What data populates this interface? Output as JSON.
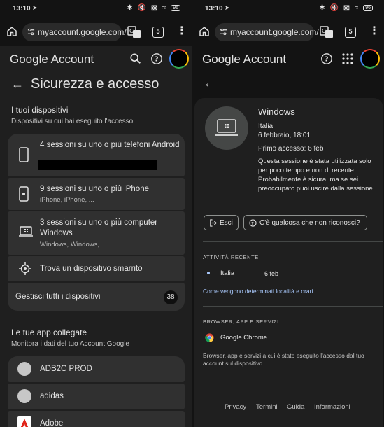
{
  "status": {
    "time": "13:10",
    "battery": "96"
  },
  "browser": {
    "url": "myaccount.google.com/",
    "tab_count": "5"
  },
  "brand": {
    "google": "Google",
    "account": "Account"
  },
  "left": {
    "page_title": "Sicurezza e accesso",
    "devices_title": "I tuoi dispositivi",
    "devices_sub": "Dispositivi su cui hai eseguito l'accesso",
    "device_android": "4 sessioni su uno o più telefoni Android",
    "device_iphone": "9 sessioni su uno o più iPhone",
    "device_iphone_sub": "iPhone, iPhone, ...",
    "device_computer": "3 sessioni su uno o più computer Windows",
    "device_computer_sub": "Windows, Windows, ...",
    "find_device": "Trova un dispositivo smarrito",
    "manage_devices": "Gestisci tutti i dispositivi",
    "manage_count": "38",
    "apps_title": "Le tue app collegate",
    "apps_sub": "Monitora i dati del tuo Account Google",
    "apps": [
      "ADB2C PROD",
      "adidas",
      "Adobe"
    ]
  },
  "right": {
    "device_name": "Windows",
    "location": "Italia",
    "datetime": "6 febbraio, 18:01",
    "first_access": "Primo accesso: 6 feb",
    "note": "Questa sessione è stata utilizzata solo per poco tempo e non di recente. Probabilmente è sicura, ma se sei preoccupato puoi uscire dalla sessione.",
    "logout_label": "Esci",
    "unknown_label": "C'è qualcosa che non riconosci?",
    "recent_caption": "ATTIVITÀ RECENTE",
    "recent_location": "Italia",
    "recent_date": "6 feb",
    "location_link": "Come vengono determinati località e orari",
    "browser_caption": "BROWSER, APP E SERVIZI",
    "browser_name": "Google Chrome",
    "browser_note": "Browser, app e servizi a cui è stato eseguito l'accesso dal tuo account sul dispositivo",
    "footer": [
      "Privacy",
      "Termini",
      "Guida",
      "Informazioni"
    ]
  }
}
